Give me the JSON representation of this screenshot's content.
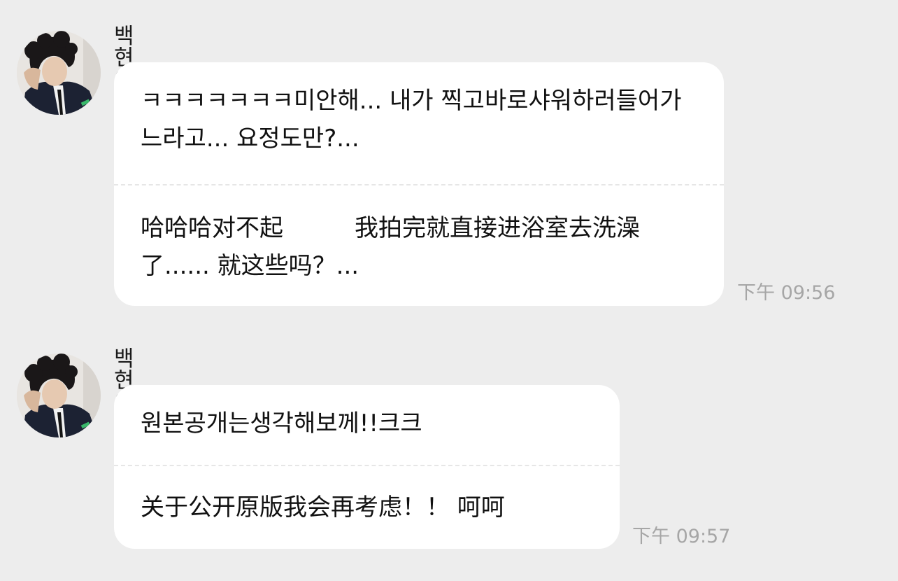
{
  "messages": [
    {
      "sender": "백현이",
      "original": "ㅋㅋㅋㅋㅋㅋㅋ미안해... 내가 찍고바로샤워하러들어가느라고... 요정도만?...",
      "translation": "哈哈哈对不起　　　我拍完就直接进浴室去洗澡了...... 就这些吗？...",
      "time": "下午 09:56"
    },
    {
      "sender": "백현이",
      "original": "원본공개는생각해보께!!크크",
      "translation": "关于公开原版我会再考虑！！ 呵呵",
      "time": "下午 09:57"
    }
  ],
  "colors": {
    "background": "#ededed",
    "bubble": "#ffffff",
    "timestamp": "#a6a6a6",
    "divider": "#e6e6e6"
  }
}
